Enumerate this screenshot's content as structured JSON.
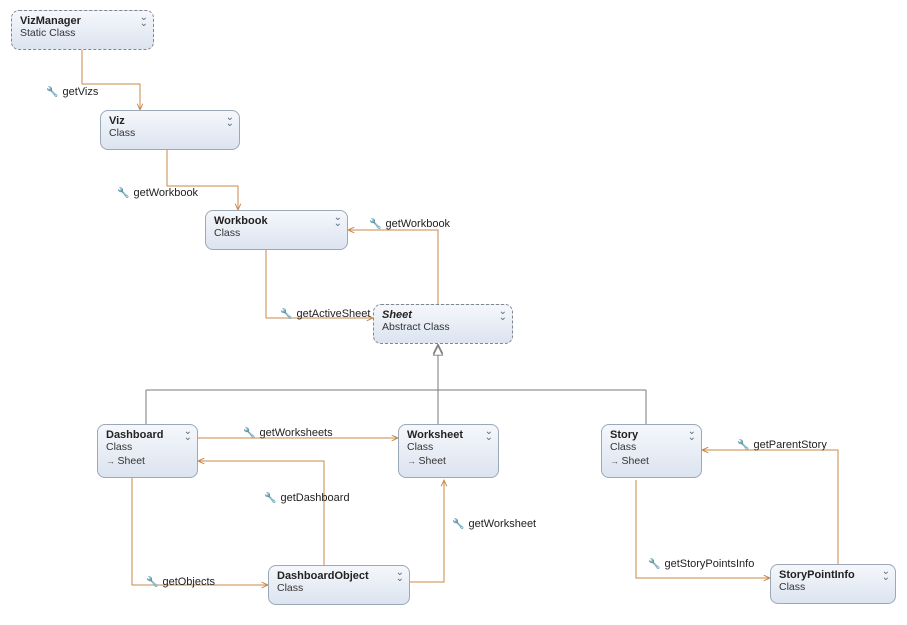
{
  "nodes": {
    "vizmanager": {
      "title": "VizManager",
      "subtitle": "Static Class"
    },
    "viz": {
      "title": "Viz",
      "subtitle": "Class"
    },
    "workbook": {
      "title": "Workbook",
      "subtitle": "Class"
    },
    "sheet": {
      "title": "Sheet",
      "subtitle": "Abstract Class"
    },
    "dashboard": {
      "title": "Dashboard",
      "subtitle": "Class",
      "detail": "Sheet"
    },
    "worksheet": {
      "title": "Worksheet",
      "subtitle": "Class",
      "detail": "Sheet"
    },
    "story": {
      "title": "Story",
      "subtitle": "Class",
      "detail": "Sheet"
    },
    "dashboardobject": {
      "title": "DashboardObject",
      "subtitle": "Class"
    },
    "storypointinfo": {
      "title": "StoryPointInfo",
      "subtitle": "Class"
    }
  },
  "edges": {
    "getVizs": "getVizs",
    "getWorkbook": "getWorkbook",
    "getWorkbook2": "getWorkbook",
    "getActiveSheet": "getActiveSheet",
    "getWorksheets": "getWorksheets",
    "getDashboard": "getDashboard",
    "getObjects": "getObjects",
    "getWorksheet": "getWorksheet",
    "getStoryPointsInfo": "getStoryPointsInfo",
    "getParentStory": "getParentStory"
  }
}
